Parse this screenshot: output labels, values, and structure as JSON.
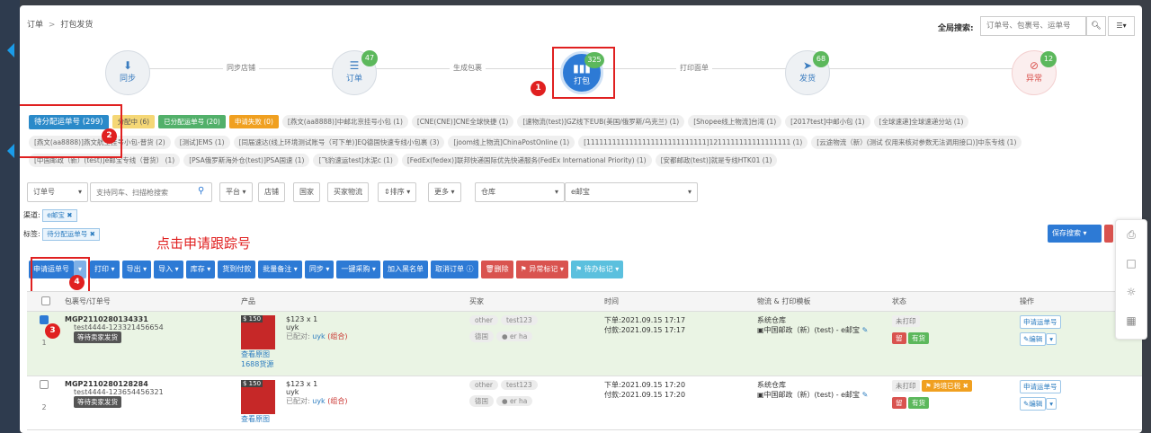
{
  "breadcrumb": {
    "root": "订单",
    "sep": ">",
    "current": "打包发货"
  },
  "global_search": {
    "label": "全局搜索:",
    "placeholder": "订单号、包裹号、运单号"
  },
  "steps": [
    {
      "label": "同步",
      "count": ""
    },
    {
      "label": "订单",
      "count": "47"
    },
    {
      "label": "打包",
      "count": "325"
    },
    {
      "label": "发货",
      "count": "68"
    },
    {
      "label": "异常",
      "count": "12"
    }
  ],
  "connectors": [
    "同步店铺",
    "生成包裹",
    "打印面单"
  ],
  "markers": [
    "1",
    "2",
    "3",
    "4"
  ],
  "status_tabs": [
    "待分配运单号 (299)",
    "分配中 (6)",
    "已分配运单号 (20)",
    "申请失败 (0)"
  ],
  "channel_tags_row1": [
    "[燕文(aa8888)]中邮北京挂号小包 (1)",
    "[CNE(CNE)]CNE全球快捷 (1)",
    "[速物流(test)]GZ线下EUB(美国/俄罗斯/乌克兰) (1)",
    "[Shopee线上物流]台湾 (1)",
    "[2017test]中邮小包 (1)",
    "[全球速递]全球速递分站 (1)"
  ],
  "channel_tags_row2": [
    "[燕文(aa8888)]燕文航空挂号小包-普货 (2)",
    "[测试]EMS (1)",
    "[同届速达(线上环境测试账号（可下单)]EQ德国快速专线小包裹 (3)",
    "[joom线上物流]ChinaPostOnline (1)",
    "[1111111111111111111111111111]1211111111111111111 (1)",
    "[云途物流（新）(测试 仅用来核对参数无法调用接口)]中东专线 (1)"
  ],
  "channel_tags_row3": [
    "[中国邮政（新）(test)]e邮宝专线（普货） (1)",
    "[PSA俄罗斯海外仓(test)]PSA国速 (1)",
    "[飞豹速运test]水泥c (1)",
    "[FedEx(fedex)]联邦快递国际优先快递服务(FedEx International Priority) (1)",
    "[安都邮政(test)]就是专线HTK01 (1)"
  ],
  "filters": {
    "order_no": "订单号",
    "search_placeholder": "支持同车、扫描枪搜索",
    "platform": "平台",
    "shop": "店铺",
    "country": "国家",
    "buyer_logistics": "买家物流",
    "sort": "排序",
    "more": "更多",
    "warehouse": "仓库",
    "channel": "e邮宝"
  },
  "selected_filters": {
    "channel_label": "渠道:",
    "channel_value": "e邮宝",
    "tag_label": "标签:",
    "tag_value": "待分配运单号",
    "save_search": "保存搜索"
  },
  "hint": "点击申请跟踪号",
  "toolbar": [
    "申请运单号",
    "打印",
    "导出",
    "导入",
    "库存",
    "货到付款",
    "批量备注",
    "同步",
    "一键采购",
    "加入黑名单",
    "取消订单",
    "删除",
    "异常标记",
    "待办标记"
  ],
  "columns": [
    "包裹号/订单号",
    "产品",
    "买家",
    "时间",
    "物流 & 打印模板",
    "状态",
    "操作"
  ],
  "rows": [
    {
      "index": "1",
      "package_no": "MGP2110280134331",
      "order_no": "test4444-123321456654",
      "badge": "等待卖家发货",
      "price": "$ 150",
      "qty": "$123 x 1",
      "sku": "uyk",
      "matched": "已配对: ",
      "match_link": "uyk",
      "combo": "(组合)",
      "link1": "查看原图",
      "link2": "1688货源",
      "buyer_platform": "other",
      "buyer_shop": "test123",
      "buyer_country": "德国",
      "buyer_name": "er ha",
      "time_order": "下单:2021.09.15 17:17",
      "time_pay": "付款:2021.09.15 17:17",
      "warehouse": "系统仓库",
      "channel": "中国邮政（新）(test) - e邮宝",
      "status": "未打印",
      "s1": "留",
      "s2": "有货",
      "s3": "",
      "action": "申请运单号",
      "edit": "编辑"
    },
    {
      "index": "2",
      "package_no": "MGP2110280128284",
      "order_no": "test4444-123654456321",
      "badge": "等待卖家发货",
      "price": "$ 150",
      "qty": "$123 x 1",
      "sku": "uyk",
      "matched": "已配对: ",
      "match_link": "uyk",
      "combo": "(组合)",
      "link1": "查看原图",
      "link2": "",
      "buyer_platform": "other",
      "buyer_shop": "test123",
      "buyer_country": "德国",
      "buyer_name": "er ha",
      "time_order": "下单:2021.09.15 17:20",
      "time_pay": "付款:2021.09.15 17:20",
      "warehouse": "系统仓库",
      "channel": "中国邮政（新）(test) - e邮宝",
      "status": "未打印",
      "s1": "留",
      "s2": "有货",
      "s3": "跨境已税",
      "action": "申请运单号",
      "edit": "编辑"
    }
  ],
  "colors": {
    "primary": "#2d7ad5",
    "danger": "#d9534f",
    "success": "#5cb85c",
    "annotation": "#e02020"
  }
}
